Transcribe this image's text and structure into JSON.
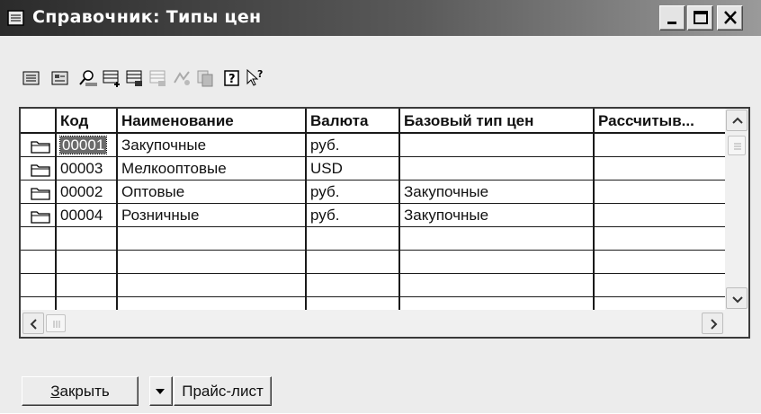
{
  "window": {
    "title": "Справочник: Типы цен"
  },
  "toolbar": {
    "icons": [
      "new-item-icon",
      "new-group-icon",
      "find-icon",
      "add-row-icon",
      "copy-row-icon",
      "delete-row-icon",
      "move-icon",
      "copy-icon",
      "help-icon",
      "context-help-icon"
    ]
  },
  "grid": {
    "columns": [
      "Код",
      "Наименование",
      "Валюта",
      "Базовый тип цен",
      "Рассчитыв..."
    ],
    "rows": [
      {
        "code": "00001",
        "name": "Закупочные",
        "currency": "руб.",
        "base": ""
      },
      {
        "code": "00003",
        "name": "Мелкооптовые",
        "currency": "USD",
        "base": ""
      },
      {
        "code": "00002",
        "name": "Оптовые",
        "currency": "руб.",
        "base": "Закупочные"
      },
      {
        "code": "00004",
        "name": "Розничные",
        "currency": "руб.",
        "base": "Закупочные"
      }
    ]
  },
  "buttons": {
    "close_label": "акрыть",
    "close_mnemonic": "З",
    "pricelist_label": "Прайс-лист"
  }
}
